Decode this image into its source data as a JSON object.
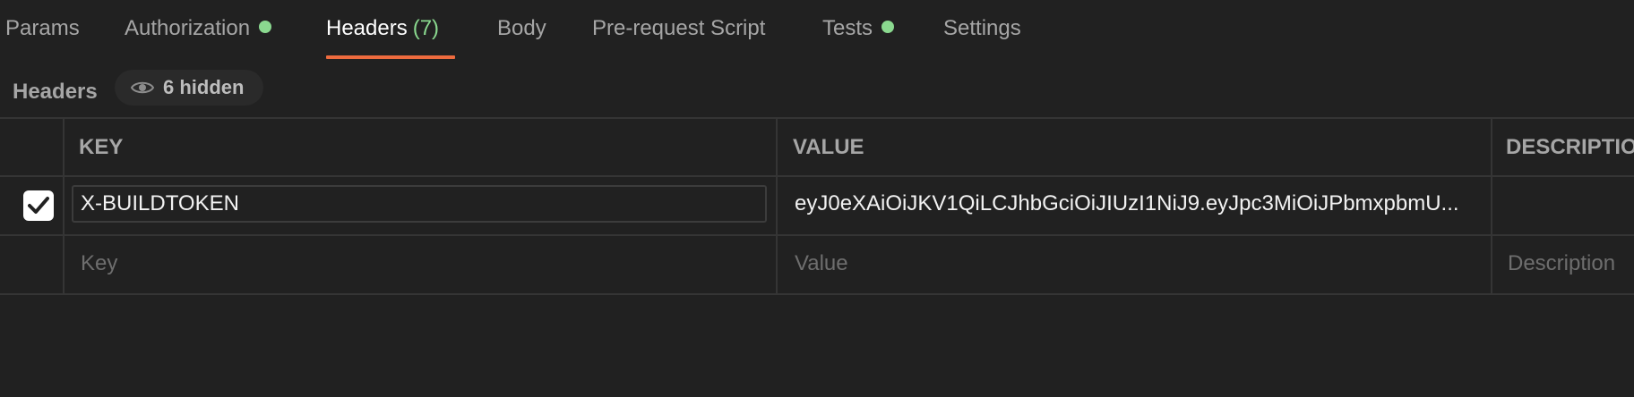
{
  "tabs": [
    {
      "label": "Params"
    },
    {
      "label": "Authorization"
    },
    {
      "label": "Headers",
      "count": "(7)"
    },
    {
      "label": "Body"
    },
    {
      "label": "Pre-request Script"
    },
    {
      "label": "Tests"
    },
    {
      "label": "Settings"
    }
  ],
  "active_tab": "Headers",
  "colors": {
    "accent_underline": "#ee6b3e",
    "status_dot": "#8ad98f",
    "background": "#212121"
  },
  "headers_section": {
    "title": "Headers",
    "hidden_label": "6 hidden"
  },
  "table": {
    "columns": [
      "KEY",
      "VALUE",
      "DESCRIPTIO"
    ],
    "rows": [
      {
        "checked": true,
        "key": "X-BUILDTOKEN",
        "value": "eyJ0eXAiOiJKV1QiLCJhbGciOiJIUzI1NiJ9.eyJpc3MiOiJPbmxpbmU...",
        "description": ""
      }
    ],
    "new_row": {
      "key_placeholder": "Key",
      "value_placeholder": "Value",
      "description_placeholder": "Description"
    }
  }
}
